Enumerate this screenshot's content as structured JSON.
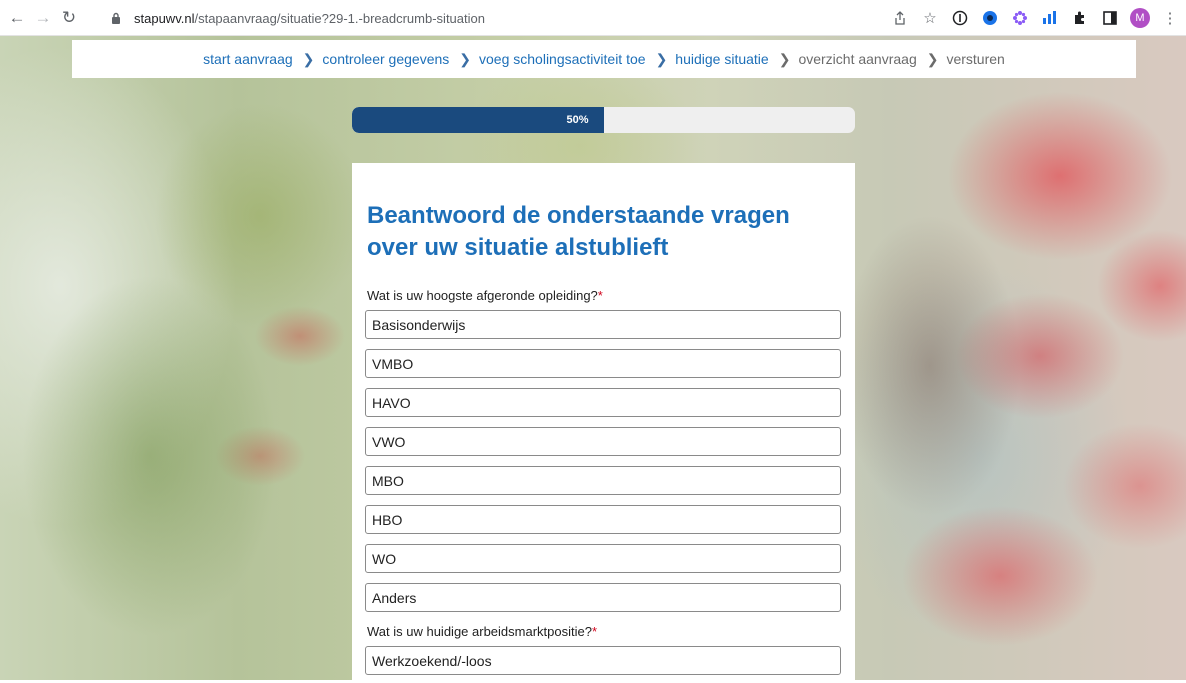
{
  "browser": {
    "url_host": "stapuwv.nl",
    "url_path": "/stapaanvraag/situatie?29-1.-breadcrumb-situation",
    "profile_initial": "M",
    "colors": {
      "profile": "#b14fc5"
    }
  },
  "breadcrumb": {
    "items": [
      {
        "label": "start aanvraag",
        "state": "link"
      },
      {
        "label": "controleer gegevens",
        "state": "link"
      },
      {
        "label": "voeg scholingsactiviteit toe",
        "state": "link"
      },
      {
        "label": "huidige situatie",
        "state": "current"
      },
      {
        "label": "overzicht aanvraag",
        "state": "upcoming"
      },
      {
        "label": "versturen",
        "state": "upcoming"
      }
    ]
  },
  "progress": {
    "label": "50%",
    "value": 0.5
  },
  "form": {
    "title": "Beantwoord de onderstaande vragen over uw situatie alstublieft",
    "question1": {
      "label": "Wat is uw hoogste afgeronde opleiding?",
      "required_mark": "*",
      "options": [
        "Basisonderwijs",
        "VMBO",
        "HAVO",
        "VWO",
        "MBO",
        "HBO",
        "WO",
        "Anders"
      ]
    },
    "question2": {
      "label": "Wat is uw huidige arbeidsmarktpositie?",
      "required_mark": "*",
      "options": [
        "Werkzoekend/-loos"
      ]
    }
  },
  "colors": {
    "primary": "#1d6fb8",
    "progress_fill": "#1a4a7e",
    "required": "#d0021b"
  }
}
